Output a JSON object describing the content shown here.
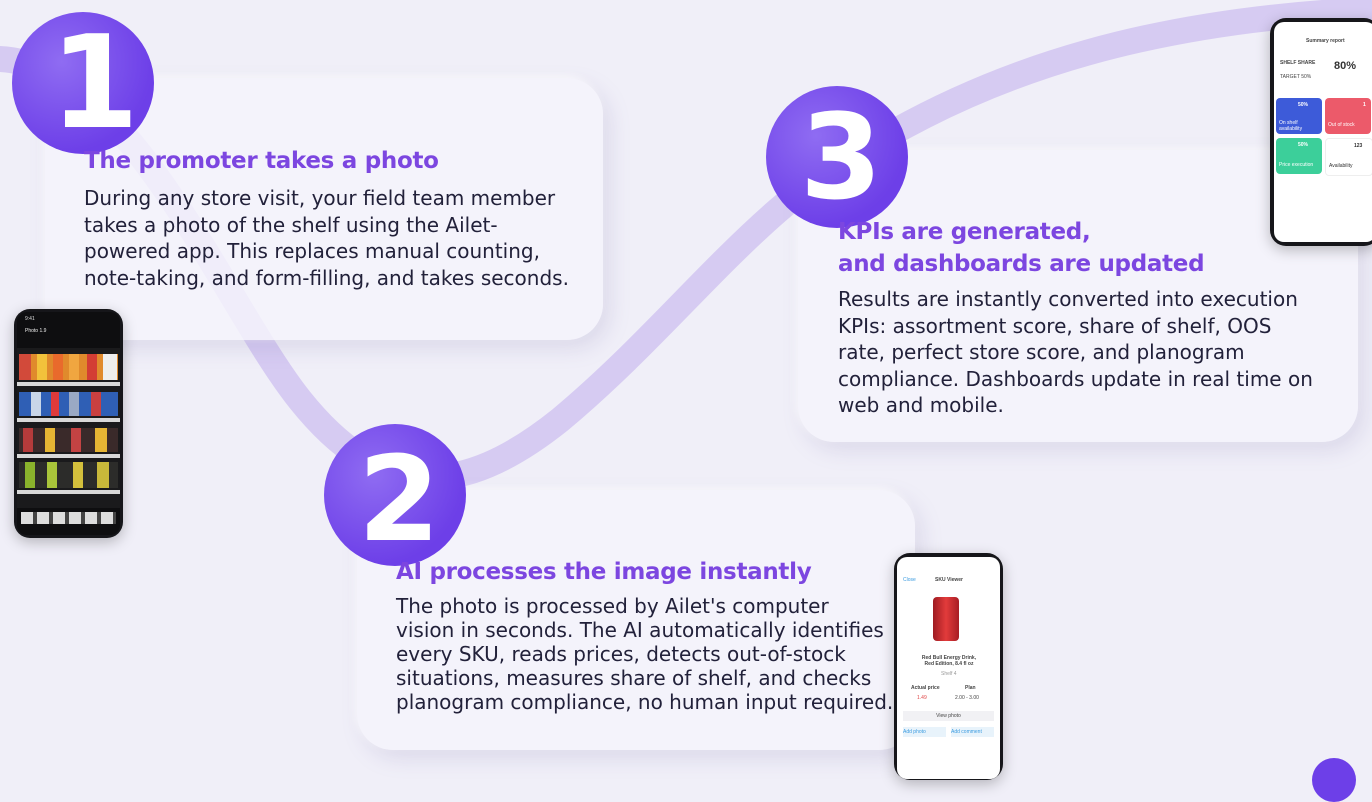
{
  "steps": [
    {
      "number": "1",
      "title": "The promoter takes a photo",
      "text_lines": [
        "During any store visit, your field team member",
        "takes a photo of the shelf using the Ailet-",
        "powered app. This replaces manual counting,",
        "note-taking, and form-filling, and takes seconds."
      ]
    },
    {
      "number": "2",
      "title": "AI processes the image instantly",
      "text_lines": [
        "The photo is processed by Ailet's computer",
        "vision in seconds. The AI automatically identifies",
        "every SKU, reads prices, detects out-of-stock",
        "situations, measures share of shelf, and checks",
        "planogram compliance, no human input required."
      ]
    },
    {
      "number": "3",
      "title_lines": [
        "KPIs are generated,",
        "and dashboards are updated"
      ],
      "text_lines": [
        "Results are instantly converted into execution",
        "KPIs: assortment score, share of shelf, OOS",
        "rate, perfect store score, and planogram",
        "compliance. Dashboards update in real time on",
        "web and mobile."
      ]
    }
  ],
  "phone_camera": {
    "time": "9:41",
    "title": "Photo 1.9"
  },
  "phone_sku": {
    "close": "Close",
    "title": "SKU Viewer",
    "product": "Red Bull Energy Drink, Red Edition, 8.4 fl oz",
    "shelf": "Shelf 4",
    "actual_price_label": "Actual price",
    "actual_price": "1.49",
    "plan_label": "Plan",
    "plan_value": "2.00 - 3.00",
    "view_photo": "View photo",
    "add_photo": "Add photo",
    "add_comment": "Add comment"
  },
  "phone_report": {
    "title": "Summary report",
    "shelf_share_label": "SHELF SHARE",
    "shelf_share_value": "80%",
    "target_label": "TARGET 50%",
    "tiles": [
      {
        "value": "50%",
        "label": "On shelf availability",
        "color": "#3d5bd9"
      },
      {
        "value": "1",
        "label": "Out of stock",
        "color": "#ec5a6a"
      },
      {
        "value": "50%",
        "label": "Price execution",
        "color": "#3ccf9a"
      },
      {
        "value": "123",
        "label": "Availability",
        "color": "#ffffff"
      }
    ]
  },
  "colors": {
    "accent": "#7c46e0",
    "number_circle": "#7a50ee",
    "background": "#f0eff8"
  }
}
